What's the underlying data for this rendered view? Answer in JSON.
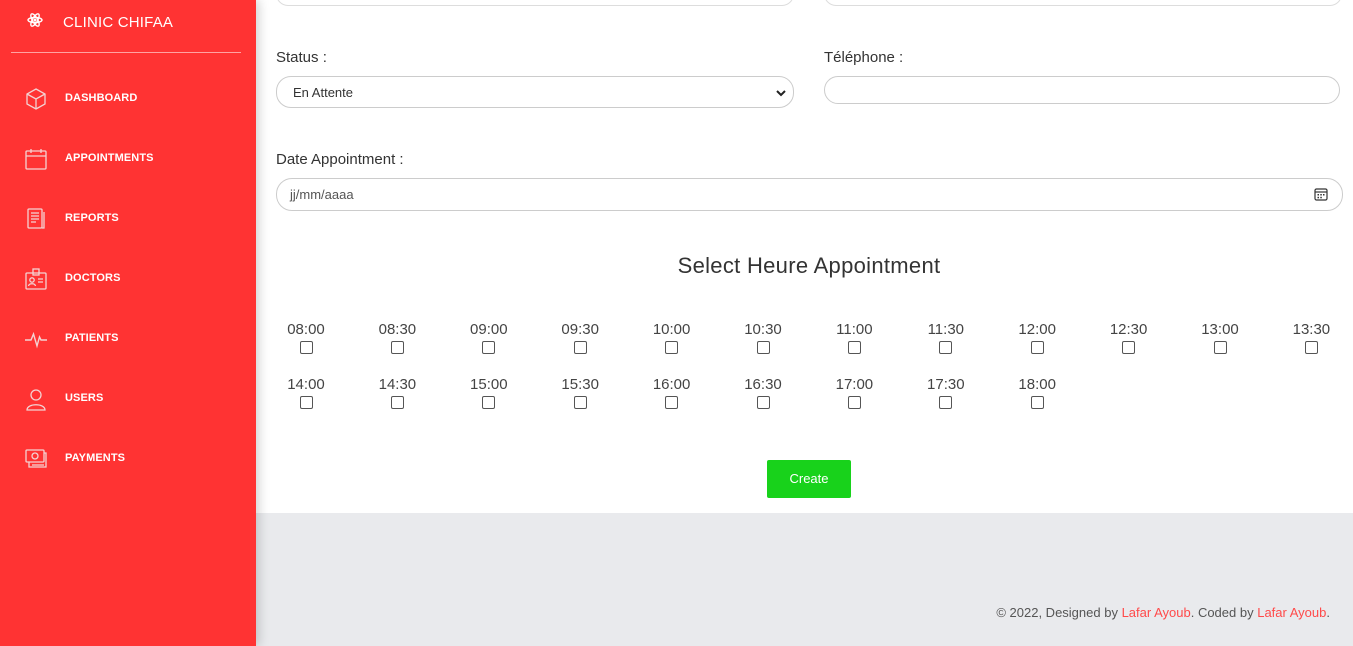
{
  "brand": {
    "name": "CLINIC CHIFAA",
    "icon": "atom-icon"
  },
  "nav": {
    "items": [
      {
        "label": "DASHBOARD",
        "icon": "cube-icon"
      },
      {
        "label": "APPOINTMENTS",
        "icon": "calendar-icon"
      },
      {
        "label": "REPORTS",
        "icon": "document-icon"
      },
      {
        "label": "DOCTORS",
        "icon": "id-badge-icon"
      },
      {
        "label": "PATIENTS",
        "icon": "pulse-icon"
      },
      {
        "label": "USERS",
        "icon": "user-icon"
      },
      {
        "label": "PAYMENTS",
        "icon": "money-icon"
      }
    ]
  },
  "form": {
    "status_label": "Status :",
    "status_value": "En Attente",
    "phone_label": "Téléphone :",
    "phone_value": "",
    "date_label": "Date Appointment :",
    "date_placeholder": "jj/mm/aaaa",
    "hours_title": "Select Heure Appointment",
    "time_slots": [
      "08:00",
      "08:30",
      "09:00",
      "09:30",
      "10:00",
      "10:30",
      "11:00",
      "11:30",
      "12:00",
      "12:30",
      "13:00",
      "13:30",
      "14:00",
      "14:30",
      "15:00",
      "15:30",
      "16:00",
      "16:30",
      "17:00",
      "17:30",
      "18:00"
    ],
    "create_label": "Create"
  },
  "footer": {
    "prefix": "© 2022, Designed by ",
    "designer": "Lafar Ayoub",
    "middle": ". Coded by ",
    "coder": "Lafar Ayoub",
    "suffix": "."
  },
  "colors": {
    "sidebar": "#ff3333",
    "create_button": "#18d21b",
    "footer_bg": "#e9eaed",
    "footer_link": "#ff4a4a"
  }
}
